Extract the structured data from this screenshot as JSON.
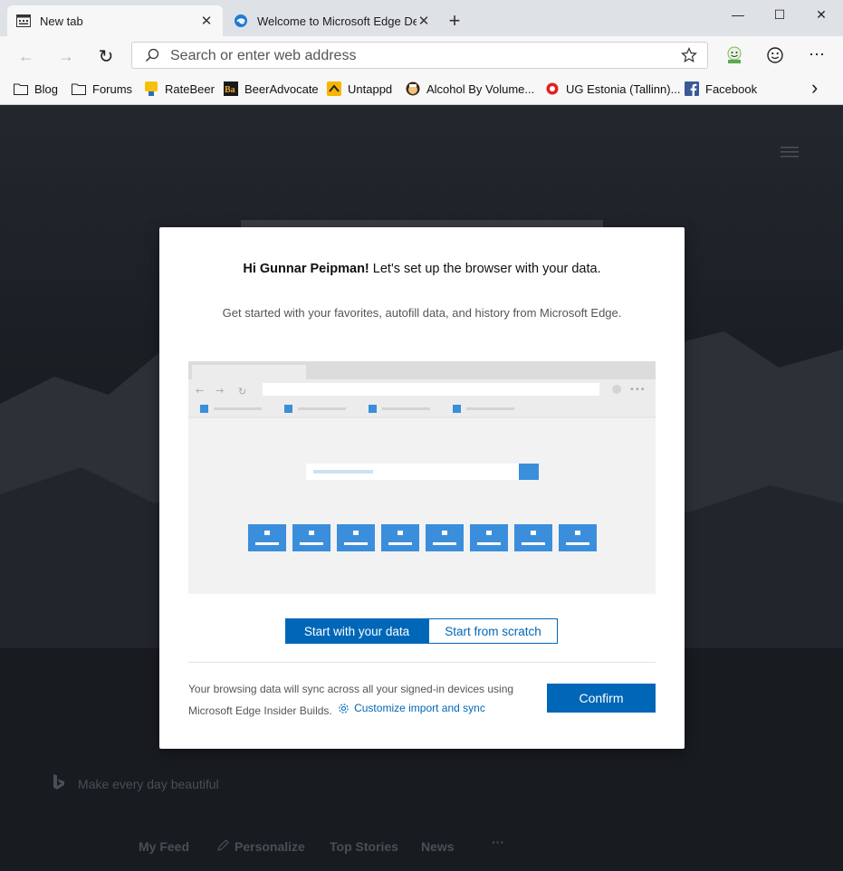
{
  "tabs": [
    {
      "label": "New tab",
      "icon": "newtab-page-icon"
    },
    {
      "label": "Welcome to Microsoft Edge Dev",
      "icon": "edge-logo-icon"
    }
  ],
  "window_controls": {
    "minimize": "—",
    "maximize": "☐",
    "close": "✕"
  },
  "toolbar": {
    "address_placeholder": "Search or enter web address",
    "back_icon": "←",
    "forward_icon": "→",
    "refresh_icon": "↻",
    "more_icon": "⋯"
  },
  "favorites": [
    {
      "label": "Blog",
      "icon": "folder-icon"
    },
    {
      "label": "Forums",
      "icon": "folder-icon"
    },
    {
      "label": "RateBeer",
      "icon": "ratebeer-icon"
    },
    {
      "label": "BeerAdvocate",
      "icon": "beeradvocate-icon"
    },
    {
      "label": "Untappd",
      "icon": "untappd-icon"
    },
    {
      "label": "Alcohol By Volume...",
      "icon": "abv-icon"
    },
    {
      "label": "UG Estonia (Tallinn)...",
      "icon": "ug-estonia-icon"
    },
    {
      "label": "Facebook",
      "icon": "facebook-icon"
    }
  ],
  "favorites_overflow": "›",
  "page": {
    "tagline": "Make every day beautiful",
    "bottom_nav": [
      "My Feed",
      "Personalize",
      "Top Stories",
      "News",
      "···"
    ]
  },
  "dialog": {
    "greeting_name": "Hi Gunnar Peipman!",
    "greeting_rest": " Let's set up the browser with your data.",
    "subtitle": "Get started with your favorites, autofill data, and history from Microsoft Edge.",
    "option_primary": "Start with your data",
    "option_secondary": "Start from scratch",
    "selected_option": "Start with your data",
    "sync_text": "Your browsing data will sync across all your signed-in devices using Microsoft Edge Insider Builds.",
    "customize_link": "Customize import and sync",
    "confirm_label": "Confirm"
  },
  "colors": {
    "accent": "#0067b8",
    "tile_blue": "#3b8edb"
  }
}
